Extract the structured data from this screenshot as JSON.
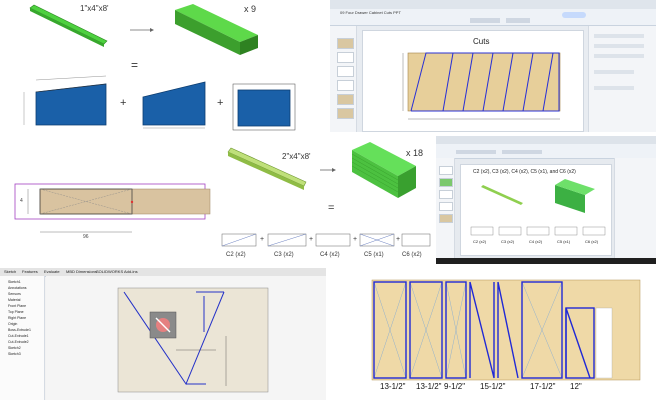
{
  "p1": {
    "board_label": "1\"x4\"x8'",
    "multiplier": "x 9",
    "equals": "=",
    "plus1": "+",
    "plus2": "+"
  },
  "p2": {
    "doc_title": "Cuts",
    "tab_title": "09 Four Drawer Cabinet Cuts PPT"
  },
  "p3": {
    "dim_bottom": "96",
    "dim_left": "4"
  },
  "p4": {
    "board_label": "2\"x4\"x8'",
    "multiplier": "x 18",
    "equals": "=",
    "parts": [
      "C2 (x2)",
      "C3 (x2)",
      "C4 (x2)",
      "C5 (x1)",
      "C6 (x2)"
    ],
    "plus": "+"
  },
  "p5": {
    "slide_title": "C2 (x2), C3 (x2), C4 (x2), C5 (x1), and C6 (x2)",
    "parts": [
      "C2 (x2)",
      "C3 (x2)",
      "C4 (x2)",
      "C5 (x1)",
      "C6 (x2)"
    ]
  },
  "p6": {
    "menu": [
      "Sketch",
      "Features",
      "Evaluate",
      "MBD Dimensions",
      "SOLIDWORKS Add-ins"
    ],
    "tree": [
      "Sketch1",
      "Annotations",
      "Sensors",
      "Material",
      "Front Plane",
      "Top Plane",
      "Right Plane",
      "Origin",
      "Boss-Extrude1",
      "Cut-Extrude1",
      "Cut-Extrude2",
      "Sketch2",
      "Sketch3"
    ]
  },
  "p7": {
    "dims": [
      "13-1/2\"",
      "13-1/2\"",
      "9-1/2\"",
      "15-1/2\"",
      "17-1/2\"",
      "12\""
    ]
  }
}
